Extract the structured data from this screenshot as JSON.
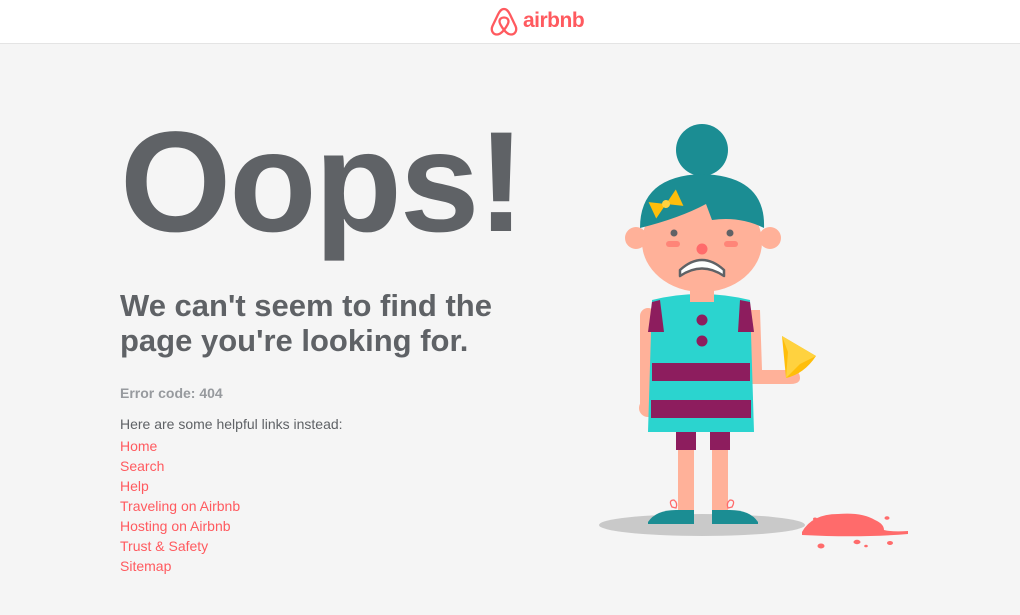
{
  "header": {
    "logo_text": "airbnb"
  },
  "main": {
    "headline": "Oops!",
    "subtitle": "We can't seem to find the page you're looking for.",
    "error_code": "Error code: 404",
    "helpful_text": "Here are some helpful links instead:",
    "links": [
      {
        "label": "Home"
      },
      {
        "label": "Search"
      },
      {
        "label": "Help"
      },
      {
        "label": "Traveling on Airbnb"
      },
      {
        "label": "Hosting on Airbnb"
      },
      {
        "label": "Trust & Safety"
      },
      {
        "label": "Sitemap"
      }
    ]
  },
  "illustration": {
    "name": "sad-girl-dropped-ice-cream-icon"
  },
  "colors": {
    "brand": "#ff5a5f",
    "text_dark": "#5f6266",
    "text_muted": "#979a9e",
    "background": "#f5f5f5"
  }
}
